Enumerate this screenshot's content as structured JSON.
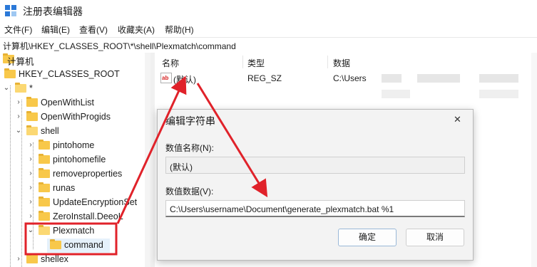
{
  "window": {
    "title": "注册表编辑器"
  },
  "menu": [
    "文件(F)",
    "编辑(E)",
    "查看(V)",
    "收藏夹(A)",
    "帮助(H)"
  ],
  "address": "计算机\\HKEY_CLASSES_ROOT\\*\\shell\\Plexmatch\\command",
  "tree": {
    "root": "计算机",
    "hive": "HKEY_CLASSES_ROOT",
    "star": "*",
    "items": [
      "OpenWithList",
      "OpenWithProgids",
      "shell",
      "pintohome",
      "pintohomefile",
      "removeproperties",
      "runas",
      "UpdateEncryptionSet",
      "ZeroInstall.DeeoL",
      "Plexmatch",
      "command",
      "shellex"
    ]
  },
  "list": {
    "columns": [
      "名称",
      "类型",
      "数据"
    ],
    "row": {
      "name": "(默认)",
      "type": "REG_SZ",
      "data": "C:\\Users"
    },
    "value_icon_text": "ab"
  },
  "dialog": {
    "title": "编辑字符串",
    "name_label": "数值名称(N):",
    "name_value": "(默认)",
    "data_label": "数值数据(V):",
    "data_value": "C:\\Users\\username\\Document\\generate_plexmatch.bat %1",
    "ok": "确定",
    "cancel": "取消",
    "close_glyph": "✕"
  },
  "colors": {
    "annotation": "#e0222a",
    "selection": "#e5f1fb",
    "folder": "#f8c84a"
  }
}
